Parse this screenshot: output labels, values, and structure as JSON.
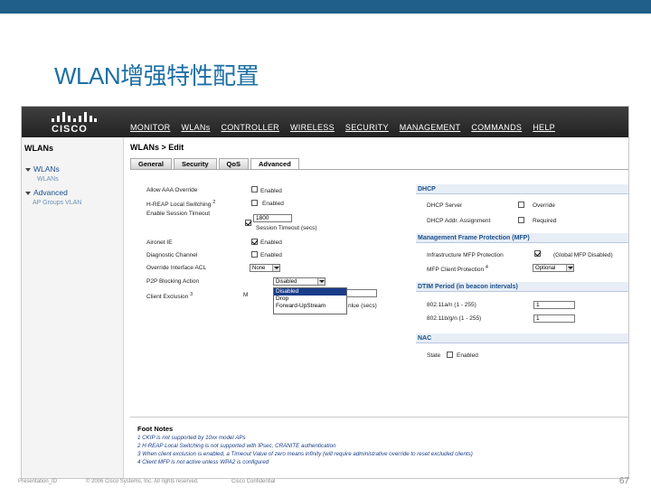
{
  "slide": {
    "title": "WLAN增强特性配置",
    "footer_left": "Presentation_ID",
    "footer_copyright": "© 2006 Cisco Systems, Inc. All rights reserved.",
    "footer_confidential": "Cisco Confidential",
    "page_number": "67"
  },
  "app": {
    "logo_text": "CISCO",
    "menu": [
      "MONITOR",
      "WLANs",
      "CONTROLLER",
      "WIRELESS",
      "SECURITY",
      "MANAGEMENT",
      "COMMANDS",
      "HELP"
    ]
  },
  "sidebar": {
    "title": "WLANs",
    "items": [
      {
        "label": "WLANs",
        "sub": "WLANs"
      },
      {
        "label": "Advanced",
        "sub": "AP Groups VLAN"
      }
    ]
  },
  "main": {
    "breadcrumb": "WLANs > Edit",
    "tabs": [
      "General",
      "Security",
      "QoS",
      "Advanced"
    ],
    "active_tab": "Advanced"
  },
  "left_form": {
    "allow_aaa_override": {
      "label": "Allow AAA Override",
      "value": "Enabled"
    },
    "hreap_switching": {
      "label": "H-REAP Local Switching",
      "sup": "2",
      "value": "Enabled"
    },
    "session_timeout": {
      "label": "Enable Session Timeout",
      "value": "1800",
      "hint": "Session Timeout (secs)"
    },
    "aironet_ie": {
      "label": "Aironet IE",
      "value": "Enabled"
    },
    "diagnostic_channel": {
      "label": "Diagnostic Channel",
      "value": "Enabled"
    },
    "override_acl": {
      "label": "Override Interface ACL",
      "value": "None"
    },
    "p2p_blocking": {
      "label": "P2P Blocking Action",
      "value": "Disabled",
      "options": [
        "Disabled",
        "Drop",
        "Forward-UpStream"
      ]
    },
    "client_exclusion": {
      "label": "Client Exclusion",
      "sup": "3",
      "hint": "nlue (secs)"
    }
  },
  "right_form": {
    "dhcp_header": "DHCP",
    "dhcp_server": {
      "label": "DHCP Server",
      "value": "Override"
    },
    "dhcp_assignment": {
      "label": "DHCP Addr. Assignment",
      "value": "Required"
    },
    "mfp_header": "Management Frame Protection (MFP)",
    "infra_mfp": {
      "label": "Infrastructure MFP Protection",
      "value": "(Global MFP Disabled)"
    },
    "mfp_client": {
      "label": "MFP Client Protection",
      "sup": "4",
      "value": "Optional"
    },
    "dtim_header": "DTIM Period (in beacon intervals)",
    "dtim_a": {
      "label": "802.11a/n (1 - 255)",
      "value": "1"
    },
    "dtim_bg": {
      "label": "802.11b/g/n (1 - 255)",
      "value": "1"
    },
    "nac_header": "NAC",
    "nac_state": {
      "label": "State",
      "value": "Enabled"
    }
  },
  "footnotes": {
    "title": "Foot Notes",
    "lines": [
      "1 CKIP is not supported by 10xx model APs",
      "2 H-REAP Local Switching is not supported with IPsec, CRANITE authentication",
      "3 When client exclusion is enabled, a Timeout Value of zero means infinity (will require administrative override to reset excluded clients)",
      "4 Client MFP is not active unless WPA2 is configured"
    ]
  },
  "colors": {
    "title_blue": "#1d6fa5",
    "topbar": "#1f5f8a",
    "navbar": "#2b2b2b",
    "link_blue": "#1a4f8a"
  }
}
